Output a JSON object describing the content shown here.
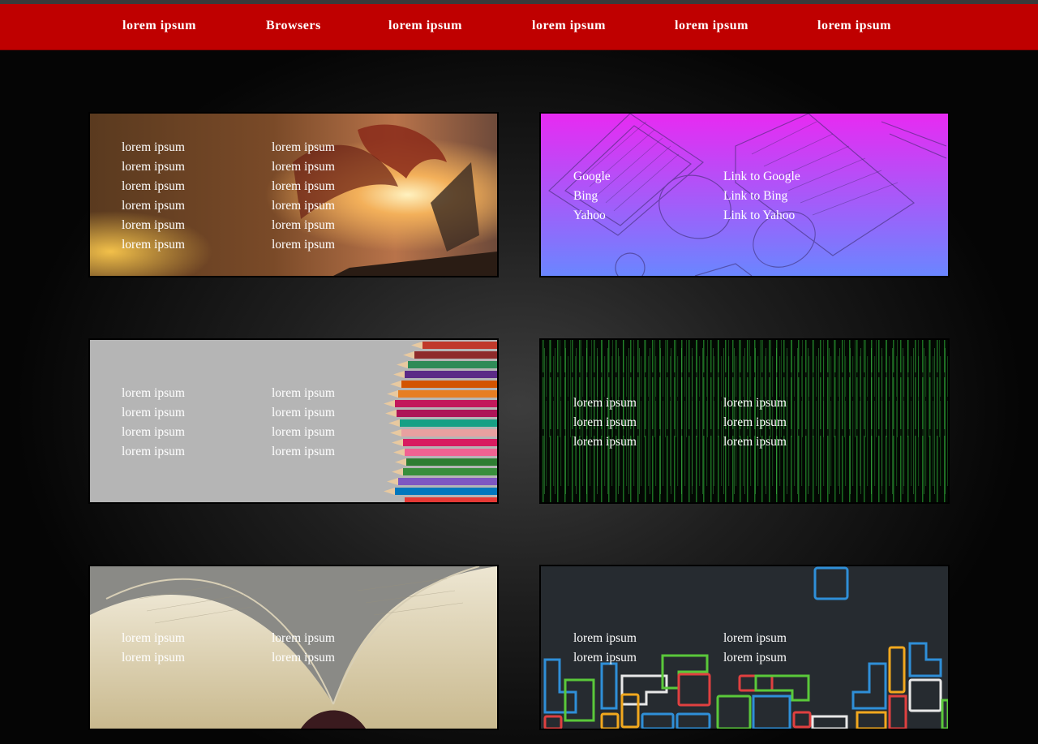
{
  "nav": {
    "items": [
      {
        "label": "lorem ipsum"
      },
      {
        "label": "Browsers"
      },
      {
        "label": "lorem ipsum"
      },
      {
        "label": "lorem ipsum"
      },
      {
        "label": "lorem ipsum"
      },
      {
        "label": "lorem ipsum"
      }
    ]
  },
  "cards": {
    "dragon": {
      "left": [
        "lorem ipsum",
        "lorem ipsum",
        "lorem ipsum",
        "lorem ipsum",
        "lorem ipsum",
        "lorem ipsum"
      ],
      "right": [
        "lorem ipsum",
        "lorem ipsum",
        "lorem ipsum",
        "lorem ipsum",
        "lorem ipsum",
        "lorem ipsum"
      ]
    },
    "browsers": {
      "left": [
        "Google",
        "Bing",
        "Yahoo"
      ],
      "right": [
        "Link to Google",
        "Link to Bing",
        "Link to Yahoo"
      ]
    },
    "pencils": {
      "left": [
        "lorem ipsum",
        "lorem ipsum",
        "lorem ipsum",
        "lorem ipsum"
      ],
      "right": [
        "lorem ipsum",
        "lorem ipsum",
        "lorem ipsum",
        "lorem ipsum"
      ]
    },
    "matrix": {
      "left": [
        "lorem ipsum",
        "lorem ipsum",
        "lorem ipsum"
      ],
      "right": [
        "lorem ipsum",
        "lorem ipsum",
        "lorem ipsum"
      ]
    },
    "book": {
      "left": [
        "lorem ipsum",
        "lorem ipsum"
      ],
      "right": [
        "lorem ipsum",
        "lorem ipsum"
      ]
    },
    "tetris": {
      "left": [
        "lorem ipsum",
        "lorem ipsum"
      ],
      "right": [
        "lorem ipsum",
        "lorem ipsum"
      ]
    }
  },
  "colors": {
    "navbar": "#bf0000",
    "text": "#ffffff",
    "browsers_gradient_top": "#e82af2",
    "browsers_gradient_bottom": "#6a86ff",
    "matrix_green": "#2fbf3a",
    "tetris_bg": "#262b30"
  }
}
